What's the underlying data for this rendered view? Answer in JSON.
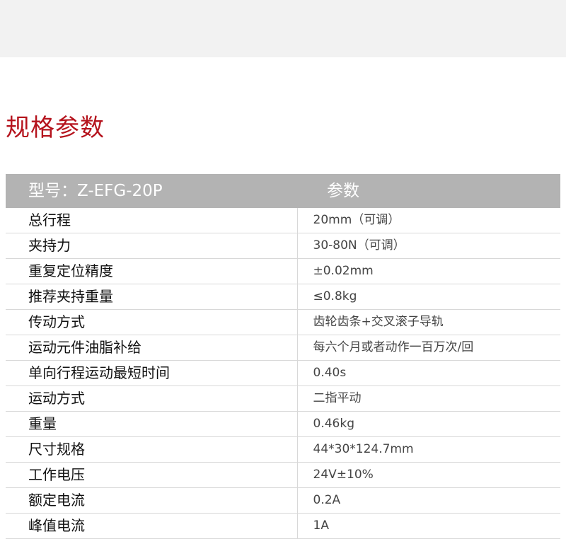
{
  "section": {
    "title": "规格参数"
  },
  "table": {
    "header_model": "型号：Z-EFG-20P",
    "header_param": "参数",
    "rows": [
      {
        "name": "总行程",
        "value": "20mm（可调）"
      },
      {
        "name": "夹持力",
        "value": "30-80N（可调）"
      },
      {
        "name": "重复定位精度",
        "value": "±0.02mm"
      },
      {
        "name": "推荐夹持重量",
        "value": "≤0.8kg"
      },
      {
        "name": "传动方式",
        "value": "齿轮齿条+交叉滚子导轨"
      },
      {
        "name": "运动元件油脂补给",
        "value": "每六个月或者动作一百万次/回"
      },
      {
        "name": "单向行程运动最短时间",
        "value": "0.40s"
      },
      {
        "name": "运动方式",
        "value": "二指平动"
      },
      {
        "name": "重量",
        "value": "0.46kg"
      },
      {
        "name": "尺寸规格",
        "value": "44*30*124.7mm"
      },
      {
        "name": "工作电压",
        "value": "24V±10%"
      },
      {
        "name": "额定电流",
        "value": "0.2A"
      },
      {
        "name": "峰值电流",
        "value": "1A"
      }
    ]
  },
  "colors": {
    "title": "#b5131d",
    "header_bg": "#b3b3b3",
    "top_band": "#f2f2f2"
  }
}
